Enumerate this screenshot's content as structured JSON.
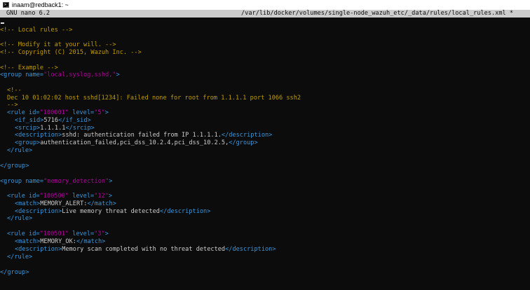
{
  "window": {
    "title": "inaam@redback1: ~"
  },
  "nano": {
    "version": "GNU nano 6.2",
    "filename": "/var/lib/docker/volumes/single-node_wazuh_etc/_data/rules/local_rules.xml *"
  },
  "colors": {
    "background": "#0c0c0c",
    "comment": "#c19c00",
    "tag": "#3a96dd",
    "value": "#b4009e",
    "text": "#cccccc"
  },
  "code": {
    "l1": {
      "comment": "<!-- Local rules -->"
    },
    "l2": {
      "comment": "<!-- Modify it at your will. -->"
    },
    "l3": {
      "comment": "<!-- Copyright (C) 2015, Wazuh Inc. -->"
    },
    "l4": {
      "comment": "<!-- Example -->"
    },
    "g1": {
      "open": "<group",
      "attr": " name=",
      "val": "\"local,syslog,sshd,\"",
      "close": ">"
    },
    "c_open": "<!--",
    "c_body": "Dec 10 01:02:02 host sshd[1234]: Failed none for root from 1.1.1.1 port 1066 ssh2",
    "c_close": "-->",
    "r1": {
      "open": "<rule",
      "a1": " id=",
      "v1": "\"100001\"",
      "a2": " level=",
      "v2": "\"5\"",
      "close": ">"
    },
    "r1_if_sid": {
      "open": "<if_sid>",
      "text": "5716",
      "close": "</if_sid>"
    },
    "r1_srcip": {
      "open": "<srcip>",
      "text": "1.1.1.1",
      "close": "</srcip>"
    },
    "r1_desc": {
      "open": "<description>",
      "text": "sshd: authentication failed from IP 1.1.1.1.",
      "close": "</description>"
    },
    "r1_group": {
      "open": "<group>",
      "text": "authentication_failed,pci_dss_10.2.4,pci_dss_10.2.5,",
      "close": "</group>"
    },
    "r1_end": "</rule>",
    "g1_end": "</group>",
    "g2": {
      "open": "<group",
      "attr": " name=",
      "val": "\"memory_detection\"",
      "close": ">"
    },
    "r2": {
      "open": "<rule",
      "a1": " id=",
      "v1": "\"100500\"",
      "a2": " level=",
      "v2": "\"12\"",
      "close": ">"
    },
    "r2_match": {
      "open": "<match>",
      "text": "MEMORY_ALERT:",
      "close": "</match>"
    },
    "r2_desc": {
      "open": "<description>",
      "text": "Live memory threat detected",
      "close": "</description>"
    },
    "r2_end": "</rule>",
    "r3": {
      "open": "<rule",
      "a1": " id=",
      "v1": "\"100501\"",
      "a2": " level=",
      "v2": "\"3\"",
      "close": ">"
    },
    "r3_match": {
      "open": "<match>",
      "text": "MEMORY_OK:",
      "close": "</match>"
    },
    "r3_desc": {
      "open": "<description>",
      "text": "Memory scan completed with no threat detected",
      "close": "</description>"
    },
    "r3_end": "</rule>",
    "g2_end": "</group>"
  }
}
